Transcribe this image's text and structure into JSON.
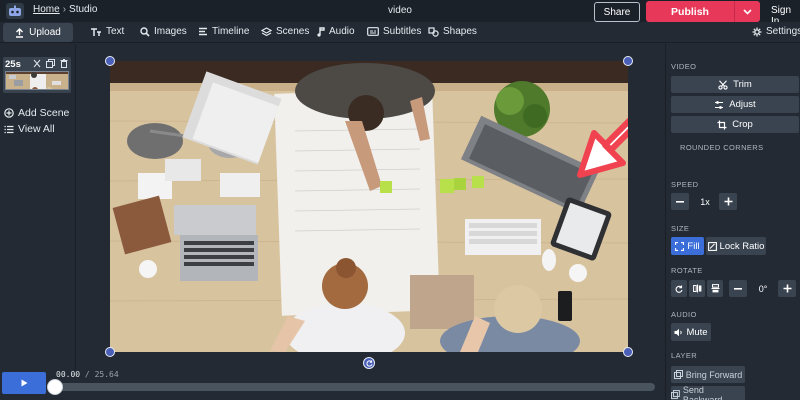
{
  "topbar": {
    "breadcrumb_home": "Home",
    "breadcrumb_sep": "›",
    "breadcrumb_current": "Studio",
    "document_title": "video",
    "share_label": "Share",
    "publish_label": "Publish",
    "signin_label": "Sign In"
  },
  "toolbar": {
    "upload_label": "Upload",
    "tools": [
      {
        "label": "Text",
        "icon": "text-icon"
      },
      {
        "label": "Images",
        "icon": "search-icon"
      },
      {
        "label": "Timeline",
        "icon": "timeline-icon"
      },
      {
        "label": "Scenes",
        "icon": "layers-icon"
      },
      {
        "label": "Audio",
        "icon": "music-note-icon"
      },
      {
        "label": "Subtitles",
        "icon": "subtitles-icon"
      },
      {
        "label": "Shapes",
        "icon": "shapes-icon"
      }
    ],
    "settings_label": "Settings"
  },
  "left_panel": {
    "scene_duration": "25s",
    "add_scene_label": "Add Scene",
    "view_all_label": "View All"
  },
  "right_panel": {
    "video_label": "VIDEO",
    "trim_label": "Trim",
    "adjust_label": "Adjust",
    "crop_label": "Crop",
    "rounded_corners_label": "ROUNDED CORNERS",
    "speed_label": "SPEED",
    "speed_value": "1x",
    "size_label": "SIZE",
    "fill_label": "Fill",
    "lock_ratio_label": "Lock Ratio",
    "rotate_label": "ROTATE",
    "rotate_value": "0°",
    "audio_label": "AUDIO",
    "mute_label": "Mute",
    "layer_label": "LAYER",
    "bring_forward_label": "Bring Forward",
    "send_backward_label": "Send Backward"
  },
  "timeline": {
    "current_time": "00.00",
    "separator": "/",
    "total_time": "25.64",
    "progress": 0
  },
  "colors": {
    "publish": "#e8385a",
    "accent_blue": "#3b6ed8",
    "annotation_arrow": "#f0424f",
    "panel_bg": "#232a33",
    "topbar_bg": "#1b2129"
  }
}
